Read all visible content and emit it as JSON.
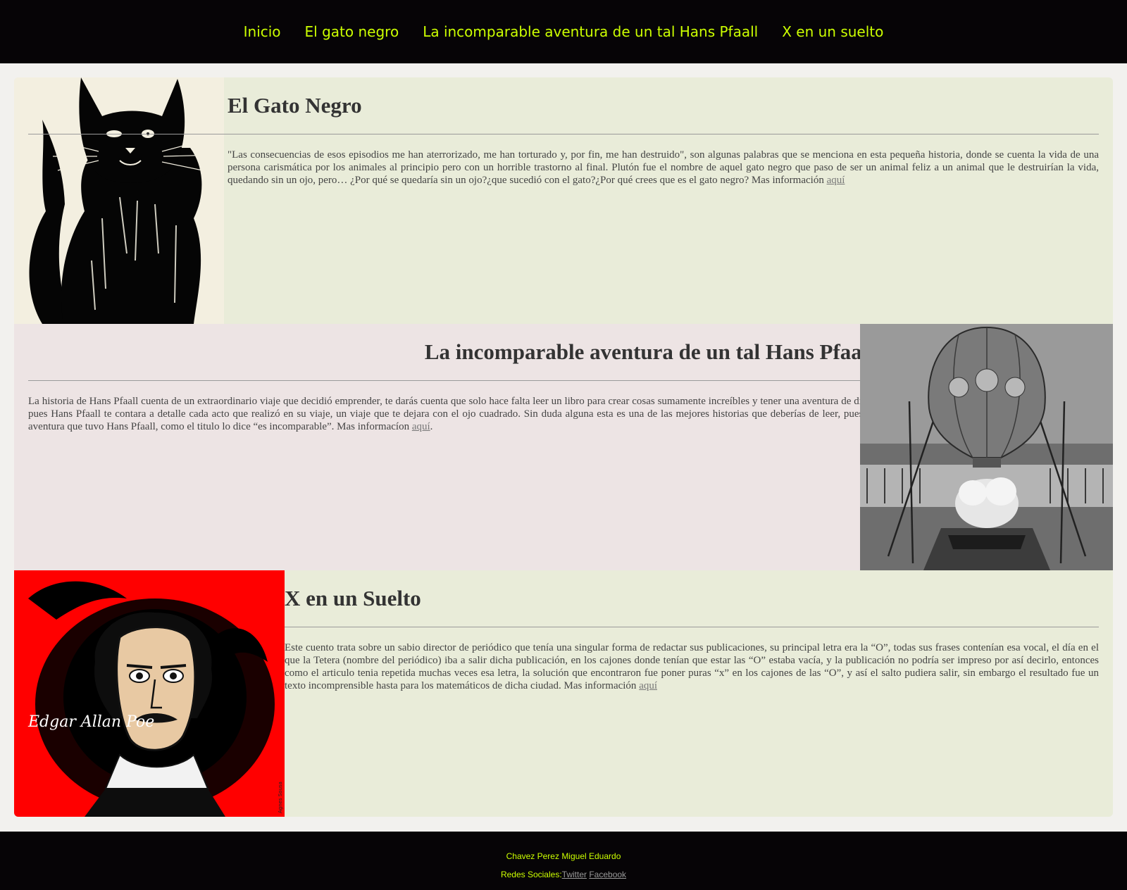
{
  "nav": {
    "items": [
      {
        "label": "Inicio"
      },
      {
        "label": "El gato negro"
      },
      {
        "label": "La incomparable aventura de un tal Hans Pfaall"
      },
      {
        "label": "X en un suelto"
      }
    ]
  },
  "sections": [
    {
      "title": "El Gato Negro",
      "text": "\"Las consecuencias de esos episodios me han aterrorizado, me han torturado y, por fin, me han destruido\", son algunas palabras que se menciona en esta pequeña historia, donde se cuenta la vida de una persona carismática por los animales al principio pero con un horrible trastorno al final. Plutón fue el nombre de aquel gato negro que paso de ser un animal feliz a un animal que le destruirían la vida, quedando sin un ojo, pero… ¿Por qué se quedaría sin un ojo?¿que sucedió con el gato?¿Por qué crees que es el gato negro? Mas información ",
      "link": "aquí",
      "after": ""
    },
    {
      "title": "La incomparable aventura de un tal Hans Pfaall",
      "text": "La historia de Hans Pfaall cuenta de un extraordinario viaje que decidió emprender, te darás cuenta que solo hace falta leer un libro para crear cosas sumamente increíbles y tener una aventura de diez, pues Hans Pfaall te contara a detalle cada acto que realizó en su viaje, un viaje que te dejara con el ojo cuadrado. Sin duda alguna esta es una de las mejores historias que deberías de leer, pues la aventura que tuvo Hans Pfaall, como el titulo lo dice “es incomparable”. Mas informacíon ",
      "link": "aquí",
      "after": "."
    },
    {
      "title": "X en un Suelto",
      "text": "Este cuento trata sobre un sabio director de periódico que tenía una singular forma de redactar sus publicaciones, su principal letra era la “O”, todas sus frases contenían esa vocal, el día en el que la Tetera (nombre del periódico) iba a salir dicha publicación, en los cajones donde tenían que estar las “O” estaba vacía, y la publicación no podría ser impreso por así decirlo, entonces como el articulo tenia repetida muchas veces esa letra, la solución que encontraron fue poner puras “x” en los cajones de las “O”, y así el salto pudiera salir, sin embargo el resultado fue un texto incomprensible hasta para los matemáticos de dicha ciudad. Mas información ",
      "link": "aquí",
      "after": ""
    }
  ],
  "images": {
    "poe_caption": "Edgar Allan Poe",
    "poe_credit": "Agnes Sousa"
  },
  "footer": {
    "author": "Chavez Perez Miguel Eduardo",
    "social_label": "Redes Sociales:",
    "twitter": "Twitter",
    "facebook": "Facebook"
  }
}
